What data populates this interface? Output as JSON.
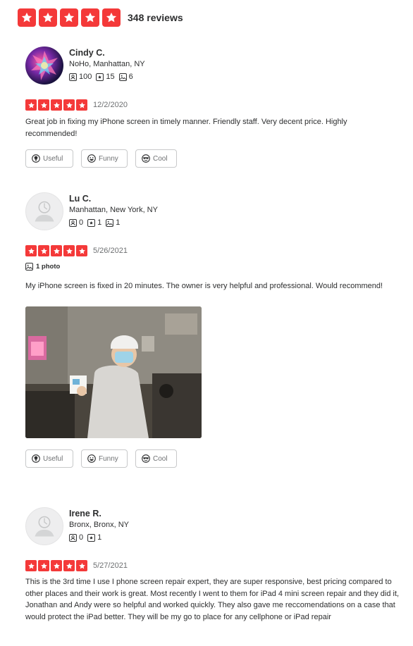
{
  "summary": {
    "rating": 5,
    "review_count_label": "348 reviews"
  },
  "reviews": [
    {
      "name": "Cindy C.",
      "location": "NoHo, Manhattan, NY",
      "stats": {
        "friends": "100",
        "reviews": "15",
        "photos": "6"
      },
      "rating": 5,
      "date": "12/2/2020",
      "text": "Great job in fixing my iPhone screen in timely manner. Friendly staff. Very decent price. Highly recommended!",
      "buttons": {
        "useful": "Useful",
        "funny": "Funny",
        "cool": "Cool"
      }
    },
    {
      "name": "Lu C.",
      "location": "Manhattan, New York, NY",
      "stats": {
        "friends": "0",
        "reviews": "1",
        "photos": "1"
      },
      "rating": 5,
      "date": "5/26/2021",
      "photo_label": "1 photo",
      "text": "My iPhone screen is fixed in 20 minutes. The owner is very helpful and professional. Would recommend!",
      "buttons": {
        "useful": "Useful",
        "funny": "Funny",
        "cool": "Cool"
      }
    },
    {
      "name": "Irene R.",
      "location": "Bronx, Bronx, NY",
      "stats": {
        "friends": "0",
        "reviews": "1"
      },
      "rating": 5,
      "date": "5/27/2021",
      "text": "This is the 3rd time I use I phone screen repair expert, they are super responsive, best pricing compared to other places and their work is great. Most recently I went to them for iPad 4 mini screen repair and they did it, Jonathan and Andy were so helpful and worked quickly. They also gave me reccomendations on a case that would protect the iPad better. They will be my go to place for any cellphone or iPad repair"
    }
  ],
  "colors": {
    "star_red": "#f43939",
    "text": "#2d2e2f",
    "muted": "#6e7072",
    "border": "#c8c9ca"
  }
}
